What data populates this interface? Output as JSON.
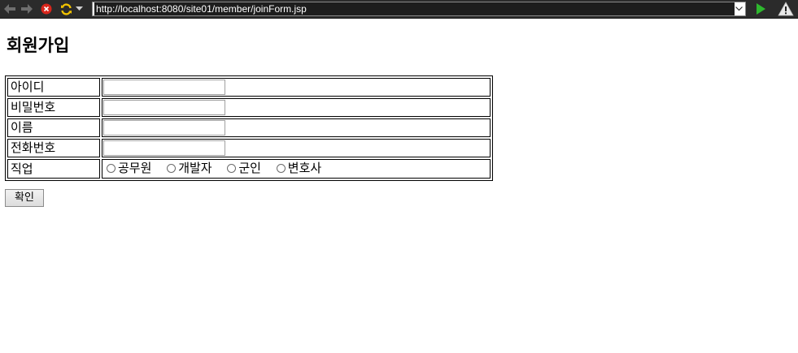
{
  "browser": {
    "url": "http://localhost:8080/site01/member/joinForm.jsp",
    "icons": {
      "back": "arrow-left-icon",
      "forward": "arrow-right-icon",
      "stop": "stop-icon",
      "refresh": "refresh-icon",
      "menu": "chevron-down-icon",
      "go": "play-icon",
      "warning": "warning-icon"
    },
    "colors": {
      "toolbar": "#2b2b2b",
      "stop": "#d9261c",
      "refresh": "#f2c300",
      "go": "#2eb82e"
    }
  },
  "page": {
    "title": "회원가입",
    "form": {
      "rows": [
        {
          "label": "아이디",
          "value": ""
        },
        {
          "label": "비밀번호",
          "value": ""
        },
        {
          "label": "이름",
          "value": ""
        },
        {
          "label": "전화번호",
          "value": ""
        }
      ],
      "job": {
        "label": "직업",
        "options": [
          "공무원",
          "개발자",
          "군인",
          "변호사"
        ]
      },
      "submit_label": "확인"
    }
  }
}
